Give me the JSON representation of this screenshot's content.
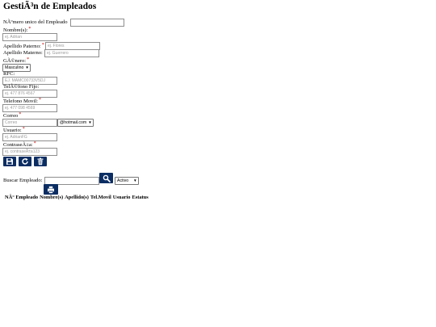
{
  "page": {
    "title": "GestiÃ³n de Empleados"
  },
  "form": {
    "numero_label": "NÃºmero unico del Empleado",
    "numero_value": "",
    "nombre_label": "Nombre(s):",
    "nombre_placeholder": "ej. Adrian",
    "apellido_paterno_label": "Apellido Paterno:",
    "apellido_paterno_placeholder": "ej. Flores",
    "apellido_materno_label": "Apellido Materno:",
    "apellido_materno_placeholder": "ej. Guerrero",
    "genero_label": "GÃ©nero:",
    "genero_selected": "Masculino",
    "rfc_label": "RFC:",
    "rfc_placeholder": "EJ. MAMC00733V5DJ",
    "telefono_fijo_label": "TelÃ©fono Fijo:",
    "telefono_fijo_placeholder": "ej. 477 876 4567",
    "telefono_movil_label": "Telefono Movil:",
    "telefono_movil_placeholder": "ej. 477 098 4569",
    "correo_label": "Correo",
    "correo_placeholder": "Correo",
    "correo_domain_selected": "@hotmail.com",
    "usuario_label": "Usuario:",
    "usuario_placeholder": "ej. AdrianFG",
    "contrasena_label": "ContraseÃ±a:",
    "contrasena_placeholder": "ej. contraseÃ±a123",
    "required_mark": "*"
  },
  "actions": {
    "save_icon": "floppy-disk-icon",
    "refresh_icon": "refresh-icon",
    "delete_icon": "trash-icon"
  },
  "search": {
    "label": "Buscar Empleado:",
    "value": "",
    "search_icon": "magnifier-icon",
    "status_selected": "Activo",
    "print_icon": "printer-icon"
  },
  "table": {
    "headers": [
      "NÂ° Empleado",
      "Nombre(s)",
      "Apellido(s)",
      "Tel.Movil",
      "Usuario",
      "Estatus"
    ]
  },
  "colors": {
    "button_bg": "#0b2d63",
    "required": "#d00000",
    "input_border": "#8e8e8e"
  }
}
